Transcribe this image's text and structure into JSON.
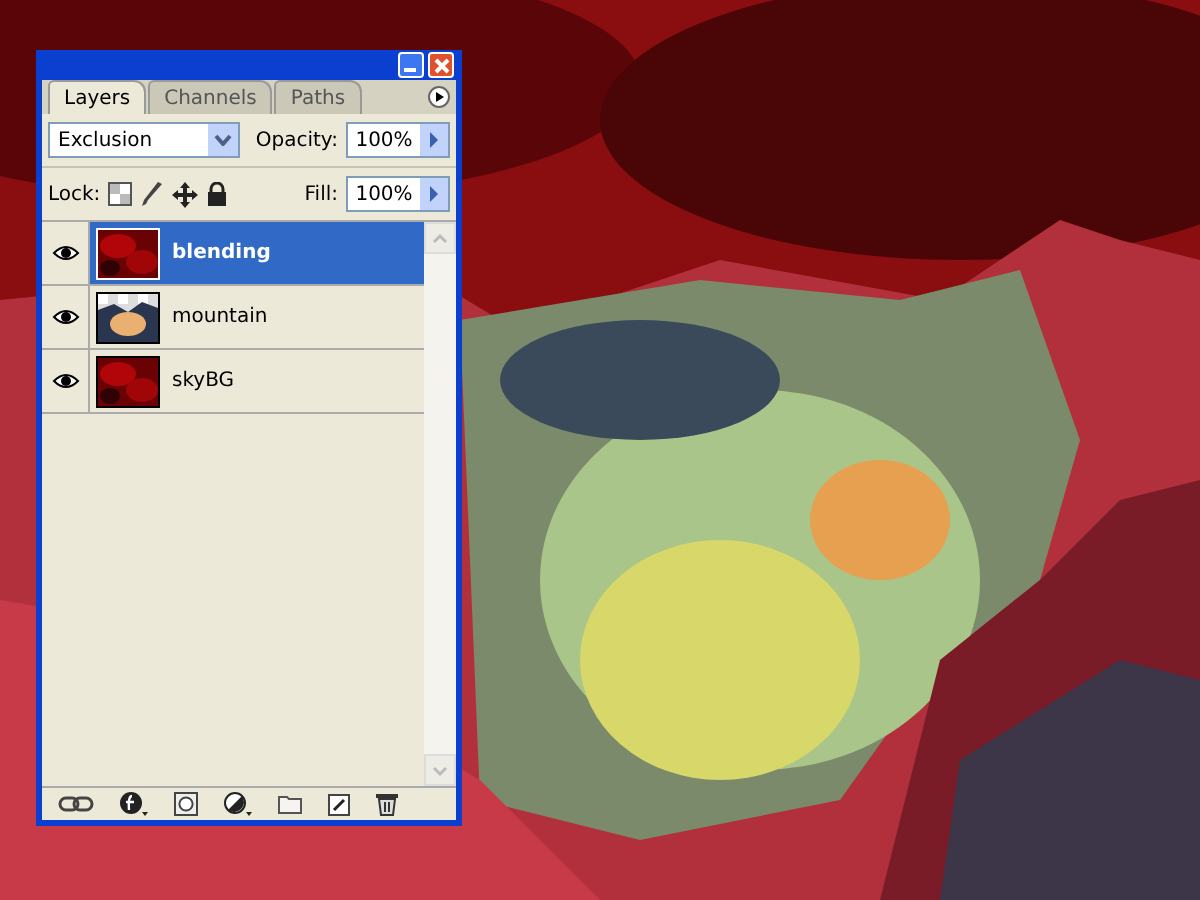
{
  "panel": {
    "tabs": [
      {
        "label": "Layers",
        "selected": true
      },
      {
        "label": "Channels",
        "selected": false
      },
      {
        "label": "Paths",
        "selected": false
      }
    ],
    "blend_mode": "Exclusion",
    "opacity_label": "Opacity:",
    "opacity": "100%",
    "lock_label": "Lock:",
    "fill_label": "Fill:",
    "fill": "100%",
    "layers": [
      {
        "name": "blending",
        "selected": true,
        "visible": true,
        "kind": "sky"
      },
      {
        "name": "mountain",
        "selected": false,
        "visible": true,
        "kind": "mountain"
      },
      {
        "name": "skyBG",
        "selected": false,
        "visible": true,
        "kind": "sky"
      }
    ]
  }
}
